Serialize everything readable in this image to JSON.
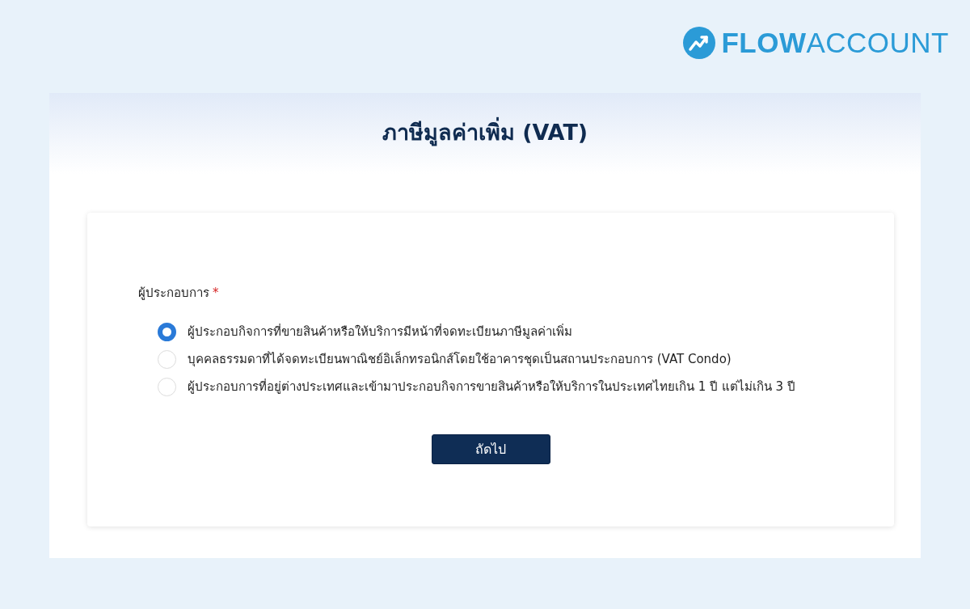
{
  "logo": {
    "text": "**FLOW**ACCOUNT"
  },
  "panel": {
    "title": "ภาษีมูลค่าเพิ่ม (VAT)"
  },
  "form": {
    "label": "ผู้ประกอบการ",
    "required_mark": "*",
    "options": [
      {
        "label": "ผู้ประกอบกิจการที่ขายสินค้าหรือให้บริการมีหน้าที่จดทะเบียนภาษีมูลค่าเพิ่ม",
        "selected": true
      },
      {
        "label": "บุคคลธรรมดาที่ได้จดทะเบียนพาณิชย์อิเล็กทรอนิกส์โดยใช้อาคารชุดเป็นสถานประกอบการ (VAT Condo)",
        "selected": false
      },
      {
        "label": "ผู้ประกอบการที่อยู่ต่างประเทศและเข้ามาประกอบกิจการขายสินค้าหรือให้บริการในประเทศไทยเกิน 1 ปี แต่ไม่เกิน 3 ปี",
        "selected": false
      }
    ],
    "button": "ถัดไป"
  }
}
